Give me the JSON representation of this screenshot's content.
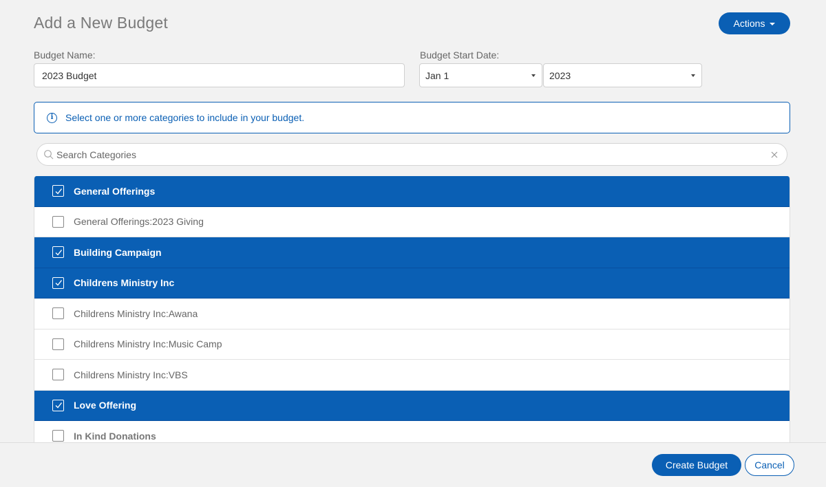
{
  "page": {
    "title": "Add a New Budget",
    "actions_label": "Actions"
  },
  "form": {
    "budget_name_label": "Budget Name:",
    "budget_name_value": "2023 Budget",
    "start_date_label": "Budget Start Date:",
    "start_day_value": "Jan 1",
    "start_year_value": "2023"
  },
  "info": {
    "message": "Select one or more categories to include in your budget."
  },
  "search": {
    "placeholder": "Search Categories"
  },
  "categories": [
    {
      "label": "General Offerings",
      "level": "parent",
      "checked": true
    },
    {
      "label": "General Offerings:2023 Giving",
      "level": "child",
      "checked": false
    },
    {
      "label": "Building Campaign",
      "level": "parent",
      "checked": true
    },
    {
      "label": "Childrens Ministry Inc",
      "level": "parent",
      "checked": true
    },
    {
      "label": "Childrens Ministry Inc:Awana",
      "level": "child",
      "checked": false
    },
    {
      "label": "Childrens Ministry Inc:Music Camp",
      "level": "child",
      "checked": false
    },
    {
      "label": "Childrens Ministry Inc:VBS",
      "level": "child",
      "checked": false
    },
    {
      "label": "Love Offering",
      "level": "parent",
      "checked": true
    },
    {
      "label": "In Kind Donations",
      "level": "parent",
      "checked": false
    }
  ],
  "footer": {
    "create_label": "Create Budget",
    "cancel_label": "Cancel"
  },
  "colors": {
    "accent": "#0a5fb4",
    "background": "#f2f2f2"
  }
}
